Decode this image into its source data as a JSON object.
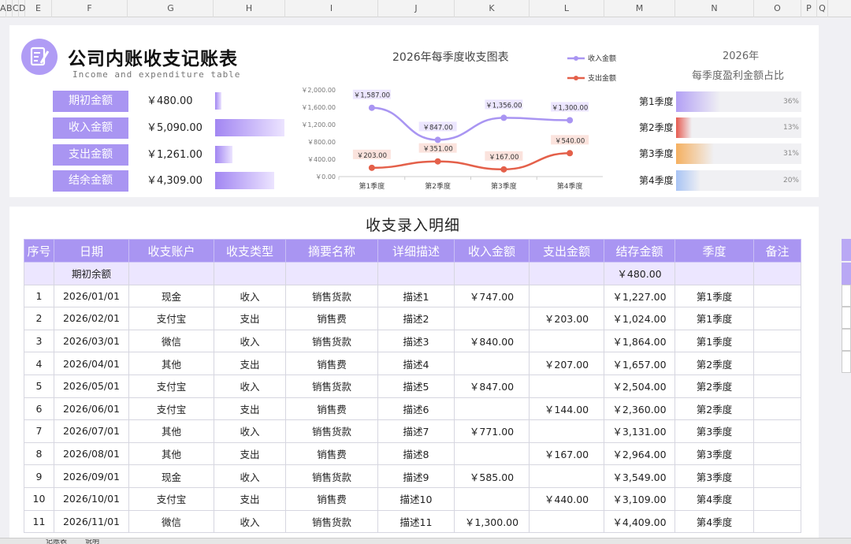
{
  "columns": [
    "A",
    "B",
    "C",
    "D",
    "E",
    "F",
    "G",
    "H",
    "I",
    "J",
    "K",
    "L",
    "M",
    "N",
    "O",
    "P",
    "Q"
  ],
  "title": "公司内账收支记账表",
  "subtitle": "Income and expenditure table",
  "summary": [
    {
      "label": "期初金额",
      "value": "￥480.00",
      "ratio": 0.09
    },
    {
      "label": "收入金额",
      "value": "￥5,090.00",
      "ratio": 1.0
    },
    {
      "label": "支出金额",
      "value": "￥1,261.00",
      "ratio": 0.25
    },
    {
      "label": "结余金额",
      "value": "￥4,309.00",
      "ratio": 0.85
    }
  ],
  "chart_data": {
    "type": "line",
    "title": "2026年每季度收支图表",
    "categories": [
      "第1季度",
      "第2季度",
      "第3季度",
      "第4季度"
    ],
    "ylim": [
      0,
      2000
    ],
    "yticks": [
      "￥0.00",
      "￥400.00",
      "￥800.00",
      "￥1,200.00",
      "￥1,600.00",
      "￥2,000.00"
    ],
    "legend_position": "top-right",
    "series": [
      {
        "name": "收入金额",
        "color": "#a995f2",
        "values": [
          1587,
          847,
          1356,
          1300
        ],
        "labels": [
          "￥1,587.00",
          "￥847.00",
          "￥1,356.00",
          "￥1,300.00"
        ]
      },
      {
        "name": "支出金额",
        "color": "#e4604a",
        "values": [
          203,
          351,
          167,
          540
        ],
        "labels": [
          "￥203.00",
          "￥351.00",
          "￥167.00",
          "￥540.00"
        ]
      }
    ]
  },
  "quarter_panel": {
    "year": "2026年",
    "subtitle": "每季度盈利金额占比",
    "items": [
      {
        "label": "第1季度",
        "pct": "36%",
        "ratio": 0.36,
        "color": "#b3a0f5"
      },
      {
        "label": "第2季度",
        "pct": "13%",
        "ratio": 0.13,
        "color": "#e65a50"
      },
      {
        "label": "第3季度",
        "pct": "31%",
        "ratio": 0.31,
        "color": "#f5b060"
      },
      {
        "label": "第4季度",
        "pct": "20%",
        "ratio": 0.2,
        "color": "#a8c4f5"
      }
    ]
  },
  "table": {
    "title": "收支录入明细",
    "headers": [
      "序号",
      "日期",
      "收支账户",
      "收支类型",
      "摘要名称",
      "详细描述",
      "收入金额",
      "支出金额",
      "结存金额",
      "季度",
      "备注"
    ],
    "opening_row": {
      "label": "期初余额",
      "balance": "￥480.00"
    },
    "rows": [
      [
        "1",
        "2026/01/01",
        "现金",
        "收入",
        "销售货款",
        "描述1",
        "￥747.00",
        "",
        "￥1,227.00",
        "第1季度",
        ""
      ],
      [
        "2",
        "2026/02/01",
        "支付宝",
        "支出",
        "销售费",
        "描述2",
        "",
        "￥203.00",
        "￥1,024.00",
        "第1季度",
        ""
      ],
      [
        "3",
        "2026/03/01",
        "微信",
        "收入",
        "销售货款",
        "描述3",
        "￥840.00",
        "",
        "￥1,864.00",
        "第1季度",
        ""
      ],
      [
        "4",
        "2026/04/01",
        "其他",
        "支出",
        "销售费",
        "描述4",
        "",
        "￥207.00",
        "￥1,657.00",
        "第2季度",
        ""
      ],
      [
        "5",
        "2026/05/01",
        "支付宝",
        "收入",
        "销售货款",
        "描述5",
        "￥847.00",
        "",
        "￥2,504.00",
        "第2季度",
        ""
      ],
      [
        "6",
        "2026/06/01",
        "支付宝",
        "支出",
        "销售费",
        "描述6",
        "",
        "￥144.00",
        "￥2,360.00",
        "第2季度",
        ""
      ],
      [
        "7",
        "2026/07/01",
        "其他",
        "收入",
        "销售货款",
        "描述7",
        "￥771.00",
        "",
        "￥3,131.00",
        "第3季度",
        ""
      ],
      [
        "8",
        "2026/08/01",
        "其他",
        "支出",
        "销售费",
        "描述8",
        "",
        "￥167.00",
        "￥2,964.00",
        "第3季度",
        ""
      ],
      [
        "9",
        "2026/09/01",
        "现金",
        "收入",
        "销售货款",
        "描述9",
        "￥585.00",
        "",
        "￥3,549.00",
        "第3季度",
        ""
      ],
      [
        "10",
        "2026/10/01",
        "支付宝",
        "支出",
        "销售费",
        "描述10",
        "",
        "￥440.00",
        "￥3,109.00",
        "第4季度",
        ""
      ],
      [
        "11",
        "2026/11/01",
        "微信",
        "收入",
        "销售货款",
        "描述11",
        "￥1,300.00",
        "",
        "￥4,409.00",
        "第4季度",
        ""
      ]
    ]
  },
  "sheet_tabs": [
    "记账表",
    "说明"
  ]
}
